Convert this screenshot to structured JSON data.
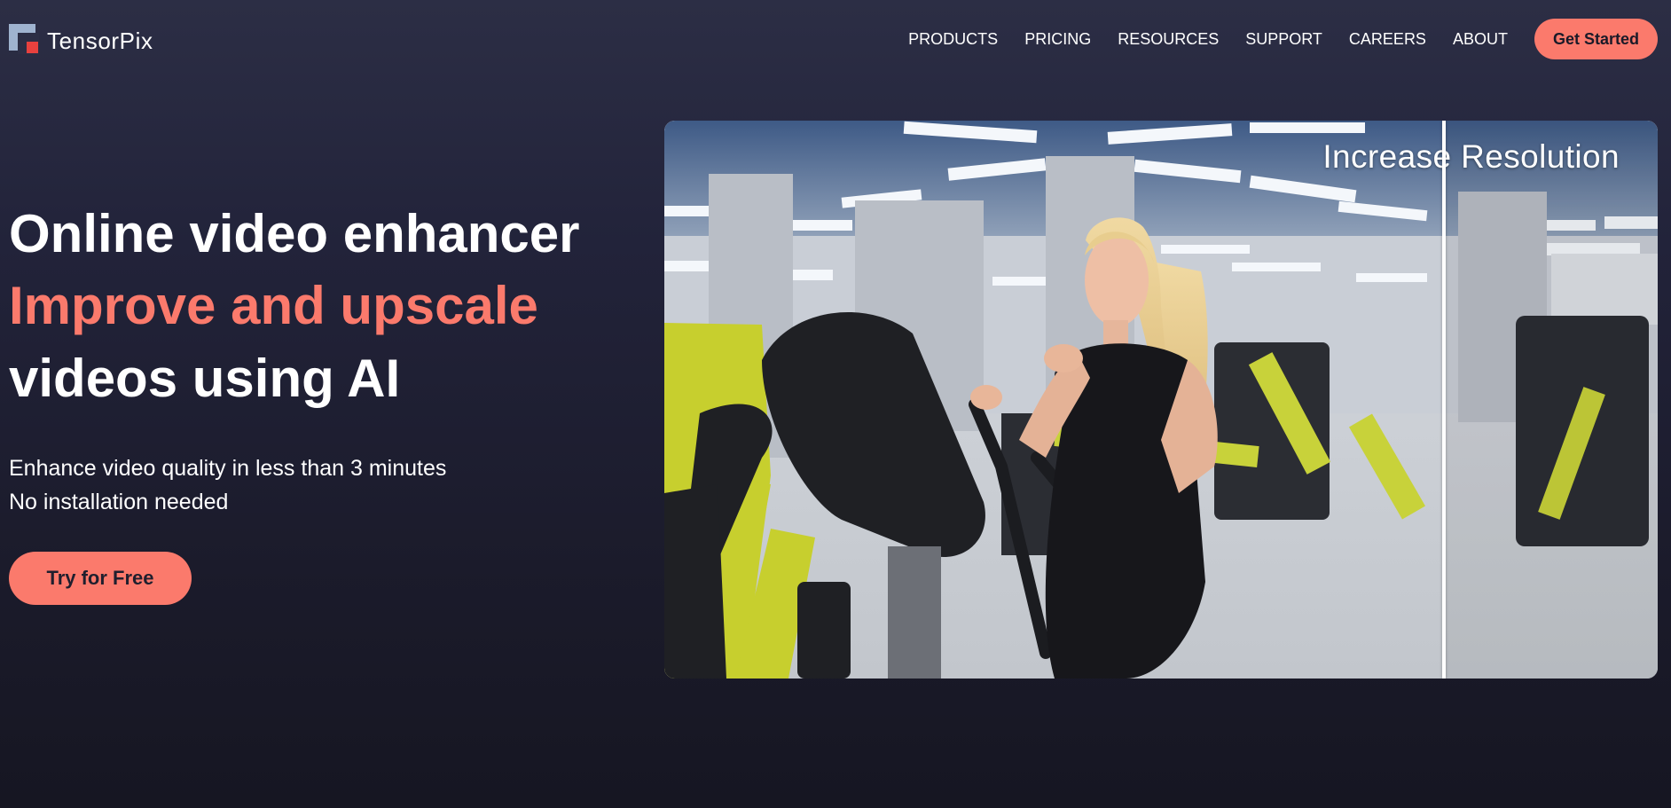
{
  "brand": {
    "name": "TensorPix",
    "logo_colors": {
      "light": "#9fb3cf",
      "accent": "#e8413e"
    }
  },
  "nav": {
    "items": [
      {
        "label": "PRODUCTS"
      },
      {
        "label": "PRICING"
      },
      {
        "label": "RESOURCES"
      },
      {
        "label": "SUPPORT"
      },
      {
        "label": "CAREERS"
      },
      {
        "label": "ABOUT"
      }
    ],
    "cta_label": "Get Started"
  },
  "hero": {
    "title_line1": "Online video enhancer",
    "title_line2": "Improve and upscale",
    "title_line3": "videos using AI",
    "subtitle_line1": "Enhance video quality in less than 3 minutes",
    "subtitle_line2": "No installation needed",
    "cta_label": "Try for Free"
  },
  "preview": {
    "caption": "Increase Resolution",
    "comparison_split": 0.785
  },
  "colors": {
    "accent": "#fb7a6c",
    "background_top": "#2c2e45",
    "background_bottom": "#161622",
    "text": "#ffffff"
  }
}
